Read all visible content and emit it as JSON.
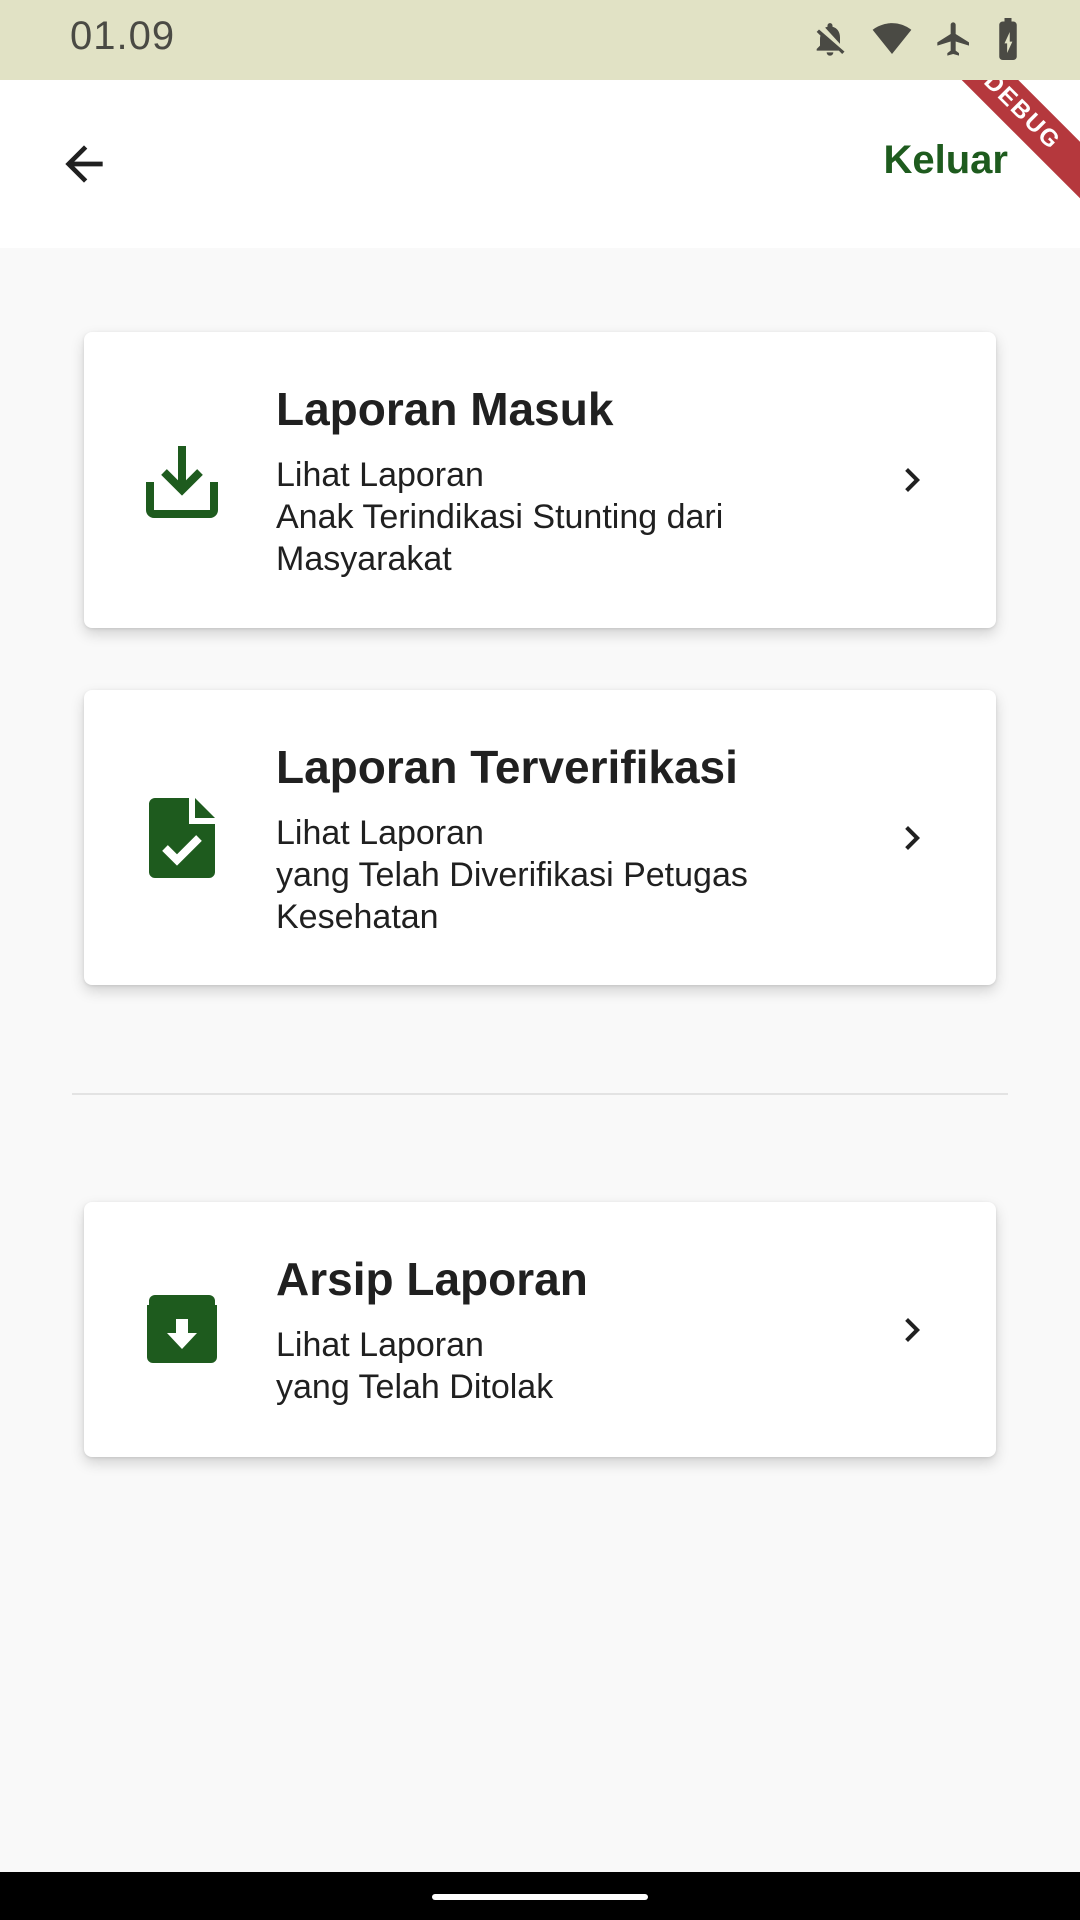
{
  "status_bar": {
    "time": "01.09",
    "icons": [
      "notifications-off-icon",
      "wifi-icon",
      "airplane-icon",
      "battery-charging-icon"
    ]
  },
  "app_bar": {
    "back_icon": "arrow-back-icon",
    "logout_label": "Keluar",
    "debug_banner": "DEBUG"
  },
  "cards": [
    {
      "icon": "download-tray-icon",
      "title": "Laporan Masuk",
      "description": "Lihat Laporan\nAnak Terindikasi Stunting dari\nMasyarakat"
    },
    {
      "icon": "file-check-icon",
      "title": "Laporan Terverifikasi",
      "description": "Lihat Laporan\nyang Telah Diverifikasi Petugas\nKesehatan"
    },
    {
      "icon": "archive-icon",
      "title": "Arsip Laporan",
      "description": "Lihat Laporan\nyang Telah Ditolak"
    }
  ],
  "colors": {
    "accent": "#1e5b1e",
    "status_bar_bg": "#e1e2c5",
    "debug_banner": "#b5383d"
  }
}
